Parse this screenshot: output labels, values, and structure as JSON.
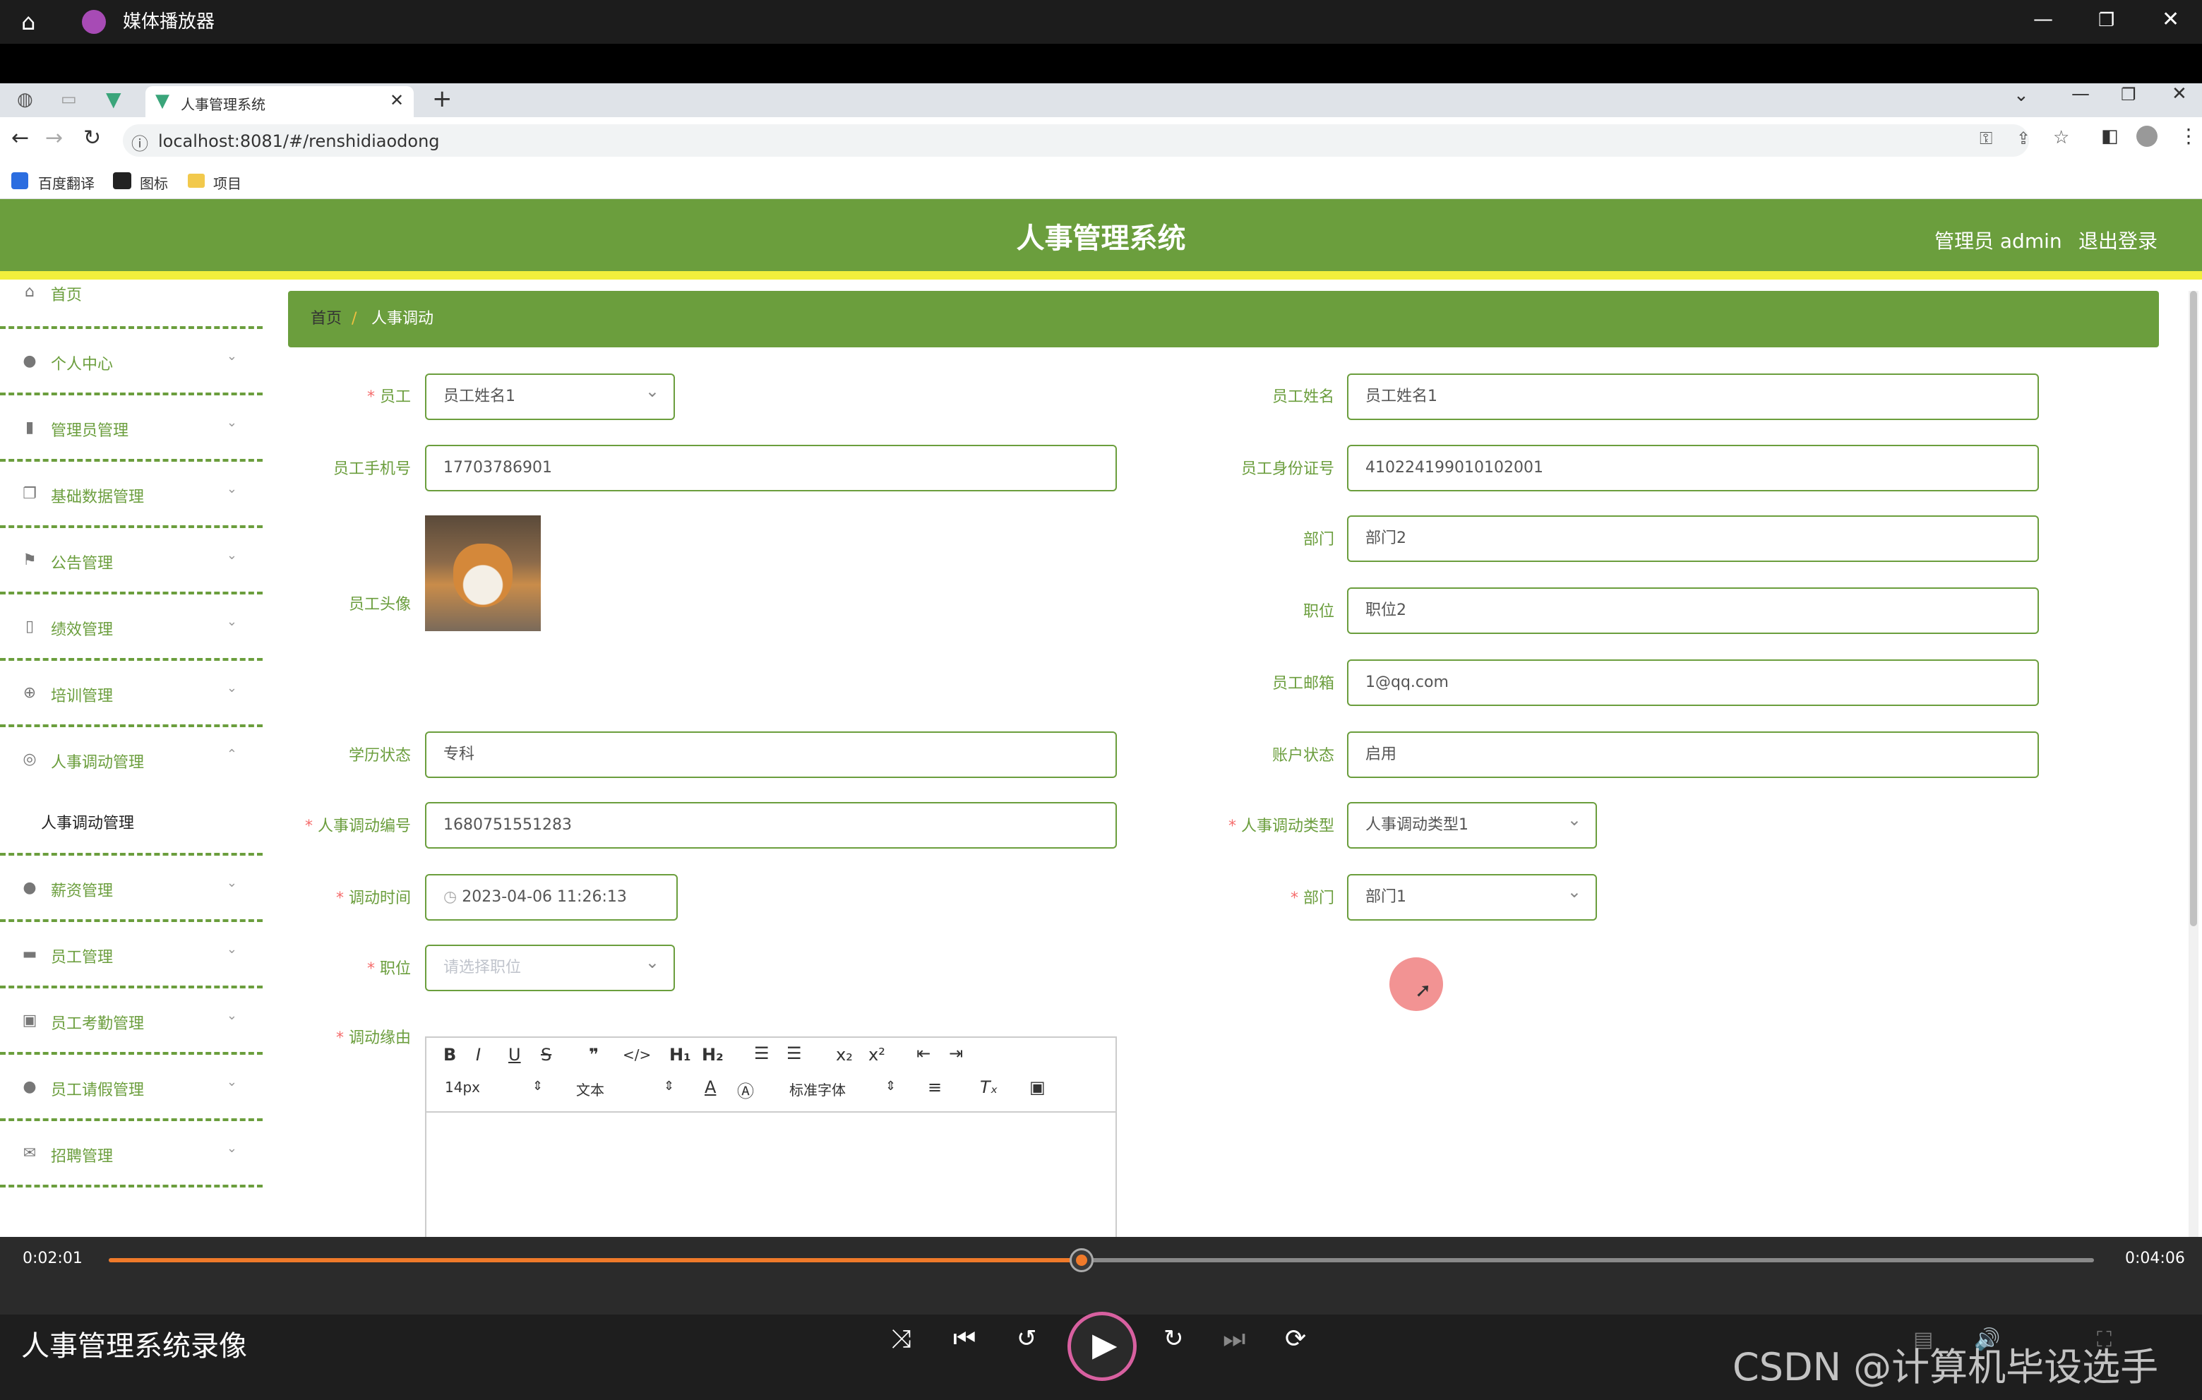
{
  "player": {
    "title": "媒体播放器",
    "video_title": "人事管理系统录像",
    "time_current": "0:02:01",
    "time_total": "0:04:06",
    "progress": 0.49,
    "watermark": "CSDN @计算机毕设选手"
  },
  "browser": {
    "tab_title": "人事管理系统",
    "url": "localhost:8081/#/renshidiaodong",
    "bookmarks": [
      "百度翻译",
      "图标",
      "项目"
    ]
  },
  "app": {
    "title": "人事管理系统",
    "user_label": "管理员 admin",
    "logout": "退出登录",
    "colors": {
      "primary": "#6b9e3d",
      "accent_bar": "#f1ef3c",
      "required": "#f56c6c"
    }
  },
  "sidebar": {
    "items": [
      {
        "label": "首页",
        "icon": "home-icon"
      },
      {
        "label": "个人中心",
        "icon": "user-icon"
      },
      {
        "label": "管理员管理",
        "icon": "chart-icon"
      },
      {
        "label": "基础数据管理",
        "icon": "copy-icon"
      },
      {
        "label": "公告管理",
        "icon": "flag-icon"
      },
      {
        "label": "绩效管理",
        "icon": "mic-icon"
      },
      {
        "label": "培训管理",
        "icon": "compass-icon"
      },
      {
        "label": "人事调动管理",
        "icon": "lifebuoy-icon"
      },
      {
        "label": "薪资管理",
        "icon": "balloon-icon"
      },
      {
        "label": "员工管理",
        "icon": "ticket-icon"
      },
      {
        "label": "员工考勤管理",
        "icon": "clipboard-icon"
      },
      {
        "label": "员工请假管理",
        "icon": "user-icon"
      },
      {
        "label": "招聘管理",
        "icon": "mail-icon"
      }
    ],
    "submenu_label": "人事调动管理"
  },
  "breadcrumb": {
    "home": "首页",
    "sep": "/",
    "current": "人事调动"
  },
  "form": {
    "employee": {
      "label": "员工",
      "value": "员工姓名1"
    },
    "employee_name": {
      "label": "员工姓名",
      "value": "员工姓名1"
    },
    "phone": {
      "label": "员工手机号",
      "value": "17703786901"
    },
    "id_card": {
      "label": "员工身份证号",
      "value": "410224199010102001"
    },
    "avatar": {
      "label": "员工头像"
    },
    "dept": {
      "label": "部门",
      "value": "部门2"
    },
    "position": {
      "label": "职位",
      "value": "职位2"
    },
    "email": {
      "label": "员工邮箱",
      "value": "1@qq.com"
    },
    "education": {
      "label": "学历状态",
      "value": "专科"
    },
    "account_status": {
      "label": "账户状态",
      "value": "启用"
    },
    "transfer_no": {
      "label": "人事调动编号",
      "value": "1680751551283"
    },
    "transfer_type": {
      "label": "人事调动类型",
      "value": "人事调动类型1"
    },
    "transfer_time": {
      "label": "调动时间",
      "value": "2023-04-06 11:26:13"
    },
    "new_dept": {
      "label": "部门",
      "value": "部门1"
    },
    "new_position": {
      "label": "职位",
      "placeholder": "请选择职位"
    },
    "reason": {
      "label": "调动缘由"
    }
  },
  "editor": {
    "font_size": "14px",
    "paragraph": "文本",
    "font_family": "标准字体",
    "tools": [
      "B",
      "I",
      "U",
      "S",
      "❞",
      "</>",
      "H1",
      "H2",
      "ol",
      "ul",
      "x₂",
      "x²",
      "outdent",
      "indent"
    ]
  }
}
